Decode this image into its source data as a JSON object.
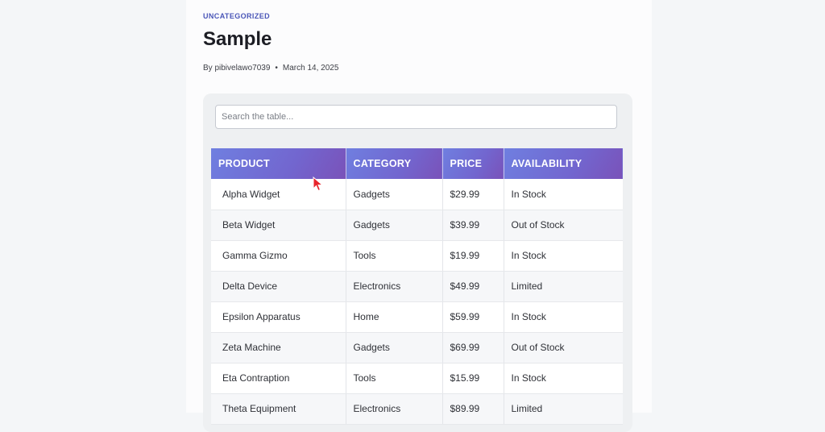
{
  "post": {
    "category": "UNCATEGORIZED",
    "title": "Sample",
    "author": "By pibivelawo7039",
    "separator": "•",
    "date": "March 14, 2025"
  },
  "search": {
    "placeholder": "Search the table...",
    "value": ""
  },
  "table": {
    "headers": [
      "PRODUCT",
      "CATEGORY",
      "PRICE",
      "AVAILABILITY"
    ],
    "rows": [
      [
        "Alpha Widget",
        "Gadgets",
        "$29.99",
        "In Stock"
      ],
      [
        "Beta Widget",
        "Gadgets",
        "$39.99",
        "Out of Stock"
      ],
      [
        "Gamma Gizmo",
        "Tools",
        "$19.99",
        "In Stock"
      ],
      [
        "Delta Device",
        "Electronics",
        "$49.99",
        "Limited"
      ],
      [
        "Epsilon Apparatus",
        "Home",
        "$59.99",
        "In Stock"
      ],
      [
        "Zeta Machine",
        "Gadgets",
        "$69.99",
        "Out of Stock"
      ],
      [
        "Eta Contraption",
        "Tools",
        "$15.99",
        "In Stock"
      ],
      [
        "Theta Equipment",
        "Electronics",
        "$89.99",
        "Limited"
      ]
    ]
  },
  "colors": {
    "header_gradient_start": "#6f7fe0",
    "header_gradient_end": "#7a52b9",
    "category_link": "#4a56b8",
    "cursor": "#e8242b"
  }
}
